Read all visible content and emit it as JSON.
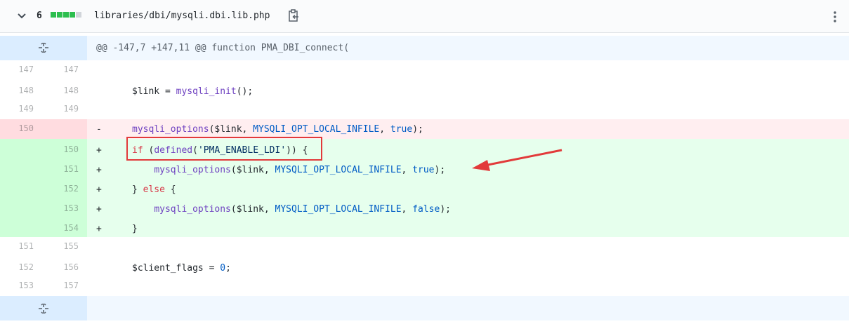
{
  "header": {
    "count": "6",
    "diffstat": {
      "added": 4,
      "neutral": 1
    },
    "filename": "libraries/dbi/mysqli.dbi.lib.php",
    "icons": {
      "collapse": "chevron-down-icon",
      "copy": "clipboard-icon",
      "more": "kebab-menu-icon",
      "expand": "unfold-icon"
    },
    "colors": {
      "added": "#2cbe4e",
      "neutral": "#d1d5da",
      "highlight": "#e23a3a"
    }
  },
  "hunk_header": "@@ -147,7 +147,11 @@ function PMA_DBI_connect(",
  "lines": [
    {
      "old": "147",
      "new": "147",
      "marker": "",
      "segments": []
    },
    {
      "old": "148",
      "new": "148",
      "marker": "",
      "segments": [
        {
          "text": "$link = ",
          "cls": "t"
        },
        {
          "text": "mysqli_init",
          "cls": "f"
        },
        {
          "text": "();",
          "cls": "t"
        }
      ]
    },
    {
      "old": "149",
      "new": "149",
      "marker": "",
      "segments": []
    },
    {
      "old": "150",
      "new": "",
      "marker": "-",
      "type": "del",
      "segments": [
        {
          "text": "mysqli_options",
          "cls": "f"
        },
        {
          "text": "($link, ",
          "cls": "t"
        },
        {
          "text": "MYSQLI_OPT_LOCAL_INFILE",
          "cls": "c"
        },
        {
          "text": ", ",
          "cls": "t"
        },
        {
          "text": "true",
          "cls": "c"
        },
        {
          "text": ");",
          "cls": "t"
        }
      ]
    },
    {
      "old": "",
      "new": "150",
      "marker": "+",
      "type": "add",
      "segments": [
        {
          "text": "if",
          "cls": "k"
        },
        {
          "text": " (",
          "cls": "t"
        },
        {
          "text": "defined",
          "cls": "f"
        },
        {
          "text": "(",
          "cls": "t"
        },
        {
          "text": "'PMA_ENABLE_LDI'",
          "cls": "s"
        },
        {
          "text": ")) {",
          "cls": "t"
        }
      ]
    },
    {
      "old": "",
      "new": "151",
      "marker": "+",
      "type": "add",
      "segments": [
        {
          "text": "    ",
          "cls": "t"
        },
        {
          "text": "mysqli_options",
          "cls": "f"
        },
        {
          "text": "($link, ",
          "cls": "t"
        },
        {
          "text": "MYSQLI_OPT_LOCAL_INFILE",
          "cls": "c"
        },
        {
          "text": ", ",
          "cls": "t"
        },
        {
          "text": "true",
          "cls": "c"
        },
        {
          "text": ");",
          "cls": "t"
        }
      ]
    },
    {
      "old": "",
      "new": "152",
      "marker": "+",
      "type": "add",
      "segments": [
        {
          "text": "} ",
          "cls": "t"
        },
        {
          "text": "else",
          "cls": "k"
        },
        {
          "text": " {",
          "cls": "t"
        }
      ]
    },
    {
      "old": "",
      "new": "153",
      "marker": "+",
      "type": "add",
      "segments": [
        {
          "text": "    ",
          "cls": "t"
        },
        {
          "text": "mysqli_options",
          "cls": "f"
        },
        {
          "text": "($link, ",
          "cls": "t"
        },
        {
          "text": "MYSQLI_OPT_LOCAL_INFILE",
          "cls": "c"
        },
        {
          "text": ", ",
          "cls": "t"
        },
        {
          "text": "false",
          "cls": "c"
        },
        {
          "text": ");",
          "cls": "t"
        }
      ]
    },
    {
      "old": "",
      "new": "154",
      "marker": "+",
      "type": "add",
      "segments": [
        {
          "text": "}",
          "cls": "t"
        }
      ]
    },
    {
      "old": "151",
      "new": "155",
      "marker": "",
      "segments": []
    },
    {
      "old": "152",
      "new": "156",
      "marker": "",
      "segments": [
        {
          "text": "$client_flags = ",
          "cls": "t"
        },
        {
          "text": "0",
          "cls": "c"
        },
        {
          "text": ";",
          "cls": "t"
        }
      ]
    },
    {
      "old": "153",
      "new": "157",
      "marker": "",
      "segments": []
    }
  ]
}
